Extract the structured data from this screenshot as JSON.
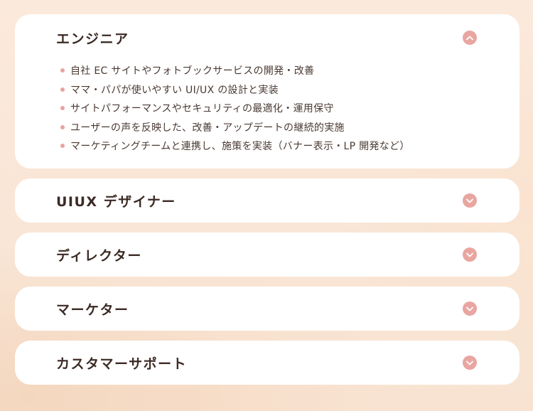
{
  "colors": {
    "accent": "#e9a6a1",
    "bullet": "#e8a49d",
    "card": "#ffffff",
    "background": "#fbe9db",
    "text": "#3b2a24"
  },
  "sections": [
    {
      "title": "エンジニア",
      "expanded": true,
      "toggle_icon": "chevron-up-icon",
      "items": [
        "自社 EC サイトやフォトブックサービスの開発・改善",
        "ママ・パパが使いやすい UI/UX の設計と実装",
        "サイトパフォーマンスやセキュリティの最適化・運用保守",
        "ユーザーの声を反映した、改善・アップデートの継続的実施",
        "マーケティングチームと連携し、施策を実装（バナー表示・LP 開発など）"
      ]
    },
    {
      "title": "UIUX デザイナー",
      "expanded": false,
      "toggle_icon": "chevron-down-icon"
    },
    {
      "title": "ディレクター",
      "expanded": false,
      "toggle_icon": "chevron-down-icon"
    },
    {
      "title": "マーケター",
      "expanded": false,
      "toggle_icon": "chevron-down-icon"
    },
    {
      "title": "カスタマーサポート",
      "expanded": false,
      "toggle_icon": "chevron-down-icon"
    }
  ]
}
